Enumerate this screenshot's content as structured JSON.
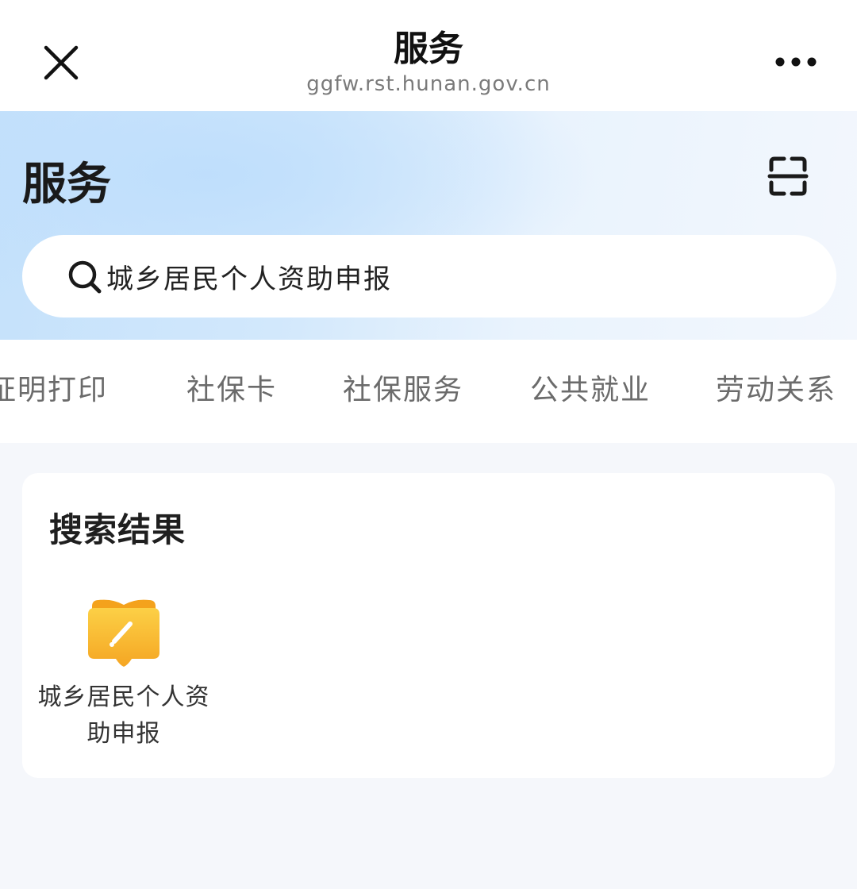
{
  "navbar": {
    "title": "服务",
    "url": "ggfw.rst.hunan.gov.cn",
    "close_icon": "close-icon",
    "more_icon": "more-icon"
  },
  "header": {
    "title": "服务",
    "scan_icon": "scan-icon"
  },
  "search": {
    "icon": "search-icon",
    "value": "城乡居民个人资助申报"
  },
  "tabs": [
    {
      "label": "证明打印"
    },
    {
      "label": "社保卡"
    },
    {
      "label": "社保服务"
    },
    {
      "label": "公共就业"
    },
    {
      "label": "劳动关系"
    }
  ],
  "results": {
    "title": "搜索结果",
    "items": [
      {
        "label": "城乡居民个人资助申报",
        "icon": "book-pen-icon",
        "icon_color": "#f7b52c"
      }
    ]
  },
  "colors": {
    "header_gradient_start": "#c4e1fb",
    "header_gradient_end": "#f3f7fd",
    "page_background": "#f5f7fb",
    "tab_text": "#6b6b6b",
    "accent_yellow": "#f7b52c"
  }
}
